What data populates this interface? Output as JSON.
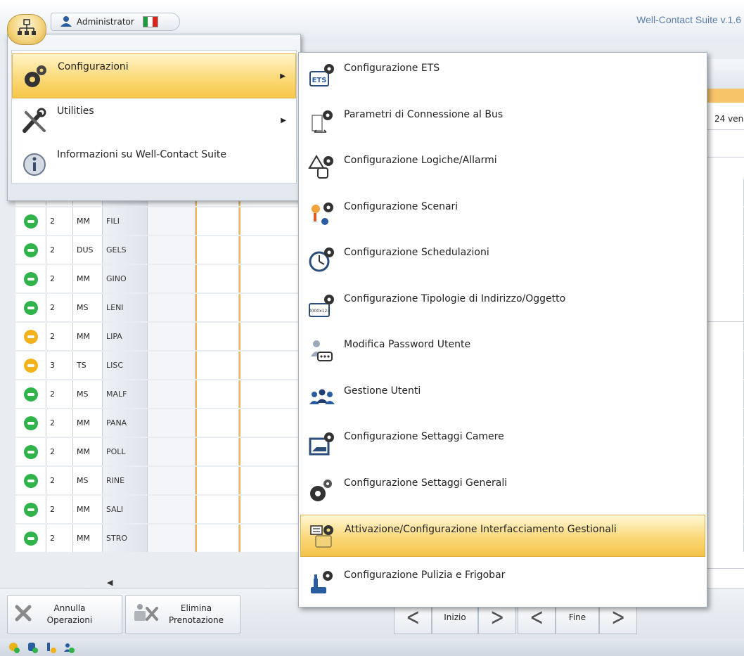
{
  "topbar": {
    "user_label": "Administrator",
    "suite_title": "Well-Contact Suite v.1.6"
  },
  "app_menu": {
    "items": [
      {
        "label": "Configurazioni",
        "has_submenu": true,
        "active": true,
        "icon": "gears-icon"
      },
      {
        "label": "Utilities",
        "has_submenu": true,
        "active": false,
        "icon": "tools-icon"
      },
      {
        "label": "Informazioni su Well-Contact Suite",
        "has_submenu": false,
        "active": false,
        "icon": "info-icon"
      }
    ]
  },
  "submenu": {
    "items": [
      {
        "label": "Configurazione ETS",
        "icon": "ets-icon",
        "active": false
      },
      {
        "label": "Parametri di Connessione al Bus",
        "icon": "bus-connection-icon",
        "active": false
      },
      {
        "label": "Configurazione Logiche/Allarmi",
        "icon": "logic-alarm-icon",
        "active": false
      },
      {
        "label": "Configurazione Scenari",
        "icon": "scenario-icon",
        "active": false
      },
      {
        "label": "Configurazione Schedulazioni",
        "icon": "schedule-clock-icon",
        "active": false
      },
      {
        "label": "Configurazione Tipologie di Indirizzo/Oggetto",
        "icon": "address-type-icon",
        "active": false
      },
      {
        "label": "Modifica Password Utente",
        "icon": "password-icon",
        "active": false
      },
      {
        "label": "Gestione Utenti",
        "icon": "users-icon",
        "active": false
      },
      {
        "label": "Configurazione Settaggi Camere",
        "icon": "room-settings-icon",
        "active": false
      },
      {
        "label": "Configurazione Settaggi Generali",
        "icon": "general-settings-icon",
        "active": false
      },
      {
        "label": "Attivazione/Configurazione Interfacciamento Gestionali",
        "icon": "management-interface-icon",
        "active": true
      },
      {
        "label": "Configurazione Pulizia e Frigobar",
        "icon": "cleaning-minibar-icon",
        "active": false
      }
    ]
  },
  "grid": {
    "date_header": "24 ven",
    "rows": [
      {
        "status": "green",
        "num": "",
        "type": "",
        "code": ""
      },
      {
        "status": "green",
        "num": "2",
        "type": "MM",
        "code": "FILI"
      },
      {
        "status": "green",
        "num": "2",
        "type": "DUS",
        "code": "GELS"
      },
      {
        "status": "green",
        "num": "2",
        "type": "MM",
        "code": "GINO"
      },
      {
        "status": "green",
        "num": "2",
        "type": "MS",
        "code": "LENI"
      },
      {
        "status": "yellow",
        "num": "2",
        "type": "MM",
        "code": "LIPA"
      },
      {
        "status": "yellow",
        "num": "3",
        "type": "TS",
        "code": "LISC"
      },
      {
        "status": "green",
        "num": "2",
        "type": "MS",
        "code": "MALF"
      },
      {
        "status": "green",
        "num": "2",
        "type": "MM",
        "code": "PANA"
      },
      {
        "status": "green",
        "num": "2",
        "type": "MM",
        "code": "POLL"
      },
      {
        "status": "green",
        "num": "2",
        "type": "MS",
        "code": "RINE"
      },
      {
        "status": "green",
        "num": "2",
        "type": "MM",
        "code": "SALI"
      },
      {
        "status": "green",
        "num": "2",
        "type": "MM",
        "code": "STRO"
      }
    ]
  },
  "toolbar": {
    "cancel_label": "Annulla Operazioni",
    "delete_label": "Elimina Prenotazione",
    "start_label": "Inizio",
    "end_label": "Fine"
  },
  "colors": {
    "status_green": "#2fb34a",
    "status_yellow": "#f2b21c",
    "accent": "#f6c74a"
  }
}
